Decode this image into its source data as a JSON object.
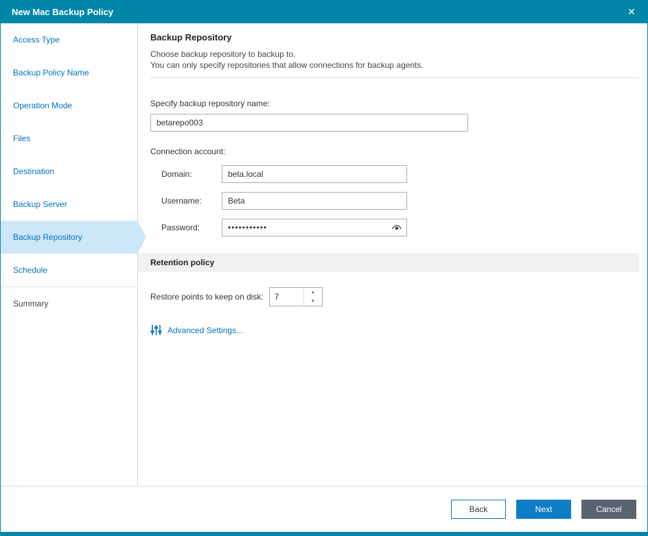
{
  "window": {
    "title": "New Mac Backup Policy"
  },
  "icons": {
    "close": "✕",
    "spinner_up": "▲",
    "spinner_down": "▼"
  },
  "sidebar": {
    "items": [
      {
        "label": "Access Type",
        "state": "link"
      },
      {
        "label": "Backup Policy Name",
        "state": "link"
      },
      {
        "label": "Operation Mode",
        "state": "link"
      },
      {
        "label": "Files",
        "state": "link"
      },
      {
        "label": "Destination",
        "state": "link"
      },
      {
        "label": "Backup Server",
        "state": "link"
      },
      {
        "label": "Backup Repository",
        "state": "active"
      },
      {
        "label": "Schedule",
        "state": "link"
      },
      {
        "label": "Summary",
        "state": "plain"
      }
    ]
  },
  "content": {
    "heading": "Backup Repository",
    "desc_line1": "Choose backup repository to backup to.",
    "desc_line2": "You can only specify repositories that allow connections for backup agents.",
    "repo_name_label": "Specify backup repository name:",
    "repo_name_value": "betarepo003",
    "connection_label": "Connection account:",
    "domain_label": "Domain:",
    "domain_value": "beta.local",
    "username_label": "Username:",
    "username_value": "Beta",
    "password_label": "Password:",
    "password_value": "•••••••••••",
    "retention_heading": "Retention policy",
    "restore_points_label": "Restore points to keep on disk:",
    "restore_points_value": "7",
    "advanced_link": "Advanced Settings..."
  },
  "footer": {
    "back_label": "Back",
    "next_label": "Next",
    "cancel_label": "Cancel"
  },
  "colors": {
    "titlebar": "#0087a7",
    "accent_blue": "#0072bc",
    "selected_step_bg": "#cde7f8",
    "next_button": "#0f7dc4",
    "cancel_button": "#5a6470"
  }
}
